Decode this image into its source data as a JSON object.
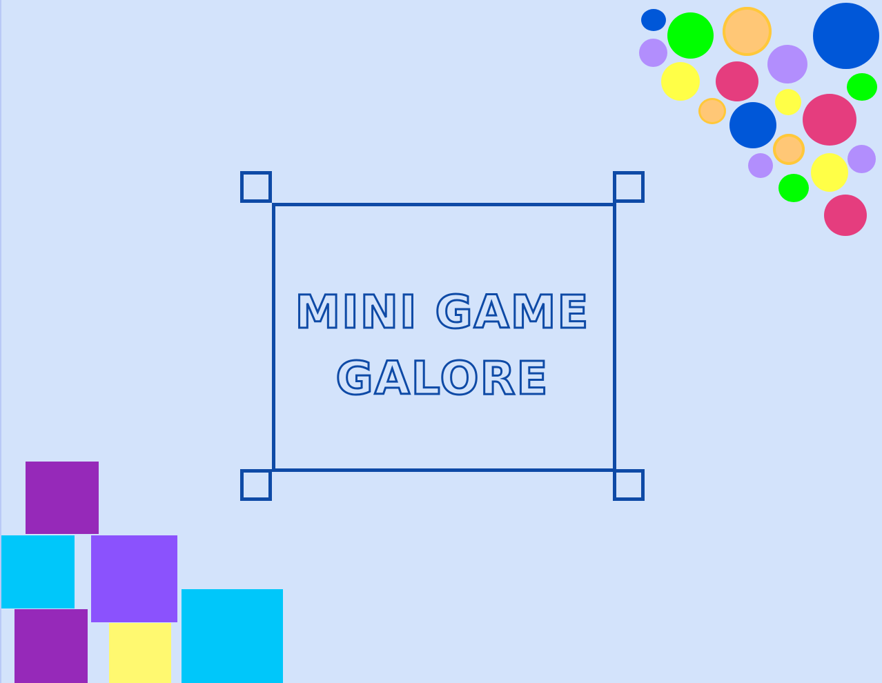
{
  "title": {
    "line1": "MINI GAME",
    "line2": "GALORE"
  },
  "colors": {
    "background": "#d3e3fb",
    "frame": "#0e4aa6",
    "purple_dark": "#9629b9",
    "purple_light": "#8b52fd",
    "cyan": "#00c7fa",
    "yellow_block": "#fff970",
    "bubble_blue": "#0057d8",
    "bubble_green": "#00ff00",
    "bubble_peach": "#ffc776",
    "bubble_lavender": "#b28efd",
    "bubble_yellow": "#ffff47",
    "bubble_pink": "#e53d7e"
  }
}
